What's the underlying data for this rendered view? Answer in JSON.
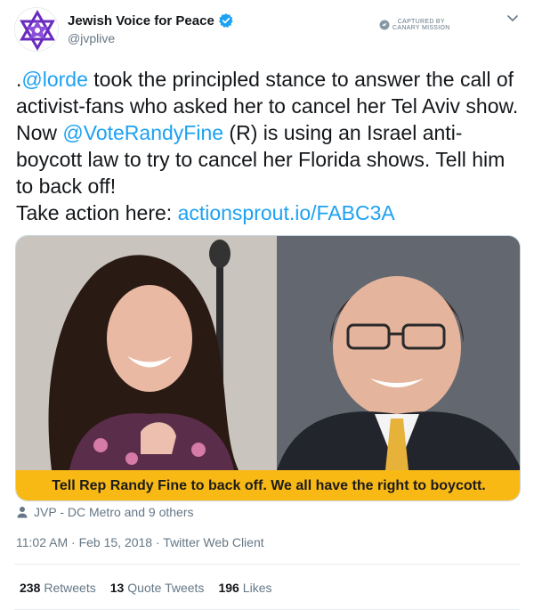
{
  "author": {
    "name": "Jewish Voice for Peace",
    "handle": "@jvplive",
    "verified": true
  },
  "captured_badge": {
    "line1": "CAPTURED BY",
    "line2": "CANARY MISSION"
  },
  "icons": {
    "avatar": "star-of-david-logo-icon",
    "verified": "verified-badge-icon",
    "menu": "chevron-down-icon",
    "person": "person-icon"
  },
  "tweet": {
    "segments": [
      {
        "text": ".",
        "type": "text"
      },
      {
        "text": "@lorde",
        "type": "link"
      },
      {
        "text": " took the principled stance to answer the call of activist-fans who asked her to cancel her Tel Aviv show. Now ",
        "type": "text"
      },
      {
        "text": "@VoteRandyFine",
        "type": "link"
      },
      {
        "text": " (R) is using an Israel anti-boycott law to try to cancel her Florida shows. Tell him to back off!\nTake action here: ",
        "type": "text"
      },
      {
        "text": "actionsprout.io/FABC3A",
        "type": "link"
      }
    ]
  },
  "media": {
    "banner_text": "Tell Rep Randy Fine to back off. We all have the right to boycott.",
    "banner_color": "#f9b915"
  },
  "context_line": "JVP - DC Metro and 9 others",
  "meta": {
    "time": "11:02 AM",
    "date": "Feb 15, 2018",
    "client": "Twitter Web Client"
  },
  "stats": {
    "retweets_count": "238",
    "retweets_label": "Retweets",
    "quotes_count": "13",
    "quotes_label": "Quote Tweets",
    "likes_count": "196",
    "likes_label": "Likes"
  },
  "colors": {
    "link": "#1da1f2",
    "secondary_text": "#657786",
    "brand_purple": "#6a2bbf"
  }
}
